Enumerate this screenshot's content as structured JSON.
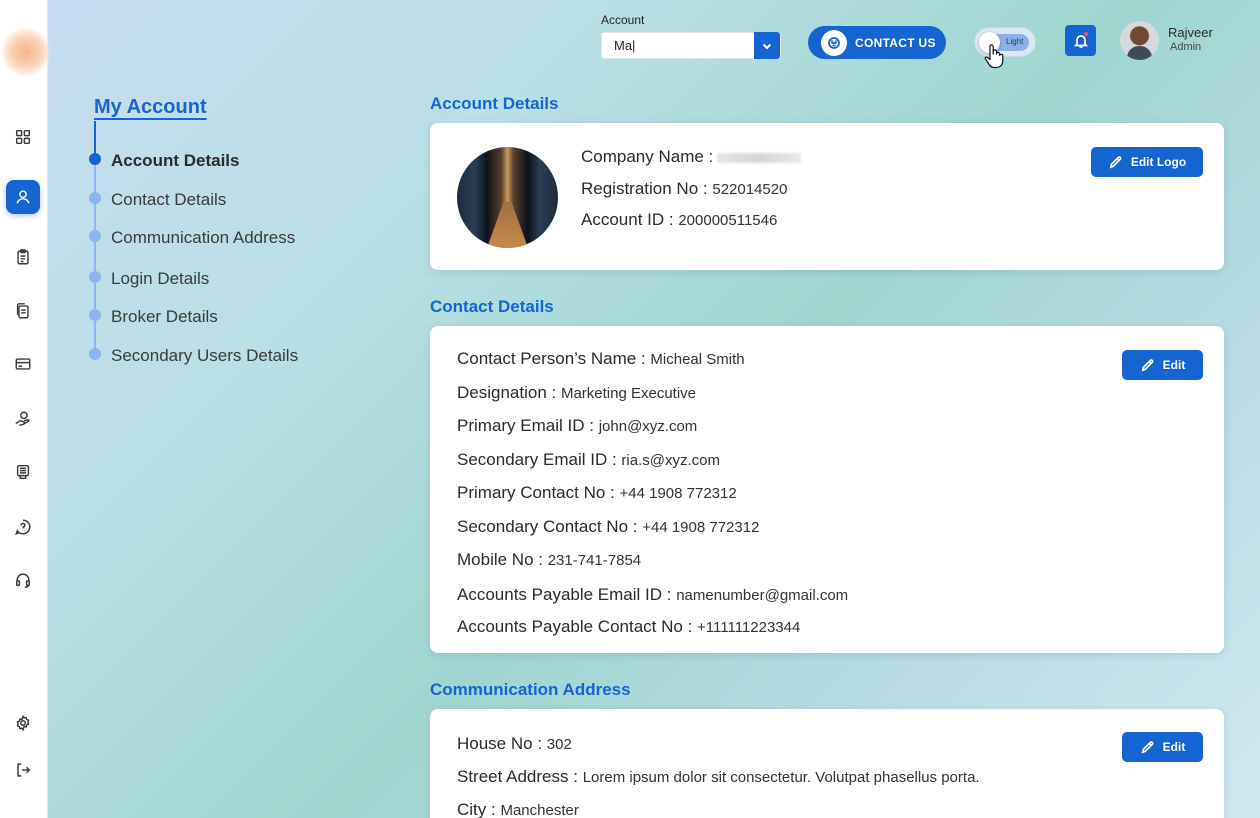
{
  "topbar": {
    "account_label": "Account",
    "account_value": "Ma|",
    "contact_label": "CONTACT US",
    "theme_label": "Light",
    "user_name": "Rajveer",
    "user_role": "Admin"
  },
  "sidebar": {
    "icons": [
      "grid-icon",
      "user-icon",
      "clipboard-icon",
      "documents-icon",
      "card-icon",
      "hand-coin-icon",
      "printer-icon",
      "help-icon",
      "headset-icon",
      "settings-icon",
      "logout-icon"
    ],
    "active": "user-icon"
  },
  "nav": {
    "title": "My Account",
    "items": [
      {
        "label": "Account Details",
        "active": true
      },
      {
        "label": "Contact Details",
        "active": false
      },
      {
        "label": "Communication Address",
        "active": false
      },
      {
        "label": "Login Details",
        "active": false
      },
      {
        "label": "Broker Details",
        "active": false
      },
      {
        "label": "Secondary Users Details",
        "active": false
      }
    ]
  },
  "account": {
    "title": "Account Details",
    "edit_label": "Edit Logo",
    "fields": [
      {
        "key": "Company Name :",
        "value": ""
      },
      {
        "key": "Registration No :",
        "value": "522014520"
      },
      {
        "key": "Account ID :",
        "value": "200000511546"
      }
    ]
  },
  "contact": {
    "title": "Contact  Details",
    "edit_label": "Edit",
    "fields": [
      {
        "key": "Contact Person’s Name :",
        "value": "Micheal Smith"
      },
      {
        "key": "Designation :",
        "value": "Marketing Executive"
      },
      {
        "key": "Primary Email ID :",
        "value": "john@xyz.com"
      },
      {
        "key": "Secondary Email ID :",
        "value": "ria.s@xyz.com"
      },
      {
        "key": "Primary Contact No :",
        "value": "+44 1908 772312"
      },
      {
        "key": "Secondary Contact No :",
        "value": "+44 1908 772312"
      },
      {
        "key": "Mobile No :",
        "value": "231-741-7854"
      },
      {
        "key": "Accounts Payable Email ID :",
        "value": "namenumber@gmail.com"
      },
      {
        "key": "Accounts Payable Contact No :",
        "value": "+111111223344"
      }
    ]
  },
  "address": {
    "title": "Communication Address",
    "edit_label": "Edit",
    "fields": [
      {
        "key": "House No :",
        "value": "302"
      },
      {
        "key": "Street Address :",
        "value": "Lorem ipsum dolor sit consectetur. Volutpat phasellus porta."
      },
      {
        "key": "City :",
        "value": "Manchester"
      }
    ]
  },
  "colors": {
    "accent": "#1464d2",
    "nav_inactive": "#8cb6ef"
  }
}
